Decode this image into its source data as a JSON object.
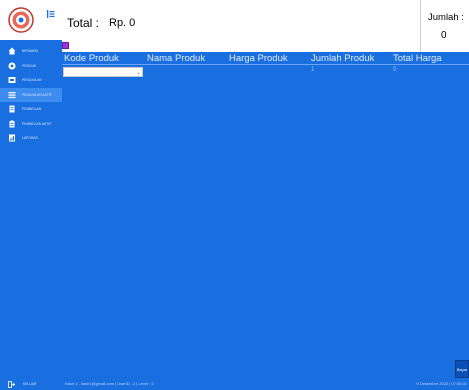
{
  "sidebar": {
    "items": [
      {
        "label": "BERANDA",
        "icon": "home-icon"
      },
      {
        "label": "PRODUK",
        "icon": "box-icon"
      },
      {
        "label": "PENJUALAN",
        "icon": "cart-icon"
      },
      {
        "label": "PENJUALAN AKTIF",
        "icon": "list-icon",
        "active": true
      },
      {
        "label": "PEMBELIAN",
        "icon": "document-icon"
      },
      {
        "label": "PEMBELIAN AKTIF",
        "icon": "clipboard-icon"
      },
      {
        "label": "LAPORAN",
        "icon": "report-icon"
      }
    ],
    "logout_label": "KELUAR"
  },
  "header": {
    "total_label": "Total :",
    "total_value": "Rp. 0",
    "jumlah_label": "Jumlah :",
    "jumlah_value": "0"
  },
  "table": {
    "columns": [
      "Kode Produk",
      "Nama Produk",
      "Harga Produk",
      "Jumlah Produk",
      "Total Harga"
    ],
    "row": {
      "jumlah": "1",
      "total": "0"
    }
  },
  "button": {
    "bayar_label": "Bayar"
  },
  "footer": {
    "left": "Kasir 1 - kasir1@gmail.com | UserID : 2 | Level : 2",
    "right": "9 Desember 2022 | 07:50:31"
  },
  "colors": {
    "accent": "#1a6fe0",
    "active": "#3d8df0",
    "checkbox": "#a033d6"
  }
}
